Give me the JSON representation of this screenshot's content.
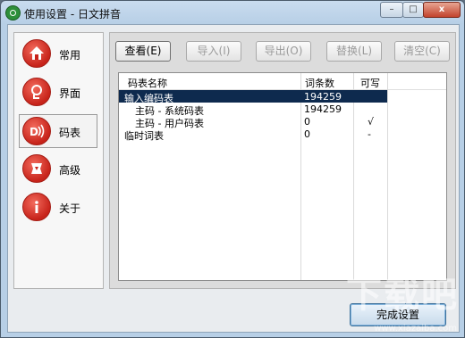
{
  "window": {
    "title": "使用设置 - 日文拼音",
    "minimize_label": "–",
    "maximize_label": "□",
    "close_label": "x"
  },
  "sidebar": {
    "items": [
      {
        "label": "常用",
        "icon": "home-icon"
      },
      {
        "label": "界面",
        "icon": "skin-icon"
      },
      {
        "label": "码表",
        "icon": "dictionary-icon",
        "active": true
      },
      {
        "label": "高级",
        "icon": "advanced-icon"
      },
      {
        "label": "关于",
        "icon": "info-icon"
      }
    ]
  },
  "toolbar": {
    "view_label": "查看(E)",
    "import_label": "导入(I)",
    "export_label": "导出(O)",
    "replace_label": "替换(L)",
    "clear_label": "清空(C)"
  },
  "table": {
    "columns": [
      "码表名称",
      "词条数",
      "可写"
    ],
    "rows": [
      {
        "name": "输入编码表",
        "count": "194259",
        "writable": "",
        "selected": true
      },
      {
        "name": "主码 - 系统码表",
        "count": "194259",
        "writable": ""
      },
      {
        "name": "主码 - 用户码表",
        "count": "0",
        "writable": "√"
      },
      {
        "name": "临时词表",
        "count": "0",
        "writable": "-"
      }
    ]
  },
  "footer": {
    "done_label": "完成设置"
  },
  "watermark": {
    "text": "下载吧",
    "sub": "www.xiazaiba.com"
  },
  "colors": {
    "accent": "#c7231a",
    "selection": "#0e2a4e",
    "titlebar": "#c9dcef"
  }
}
